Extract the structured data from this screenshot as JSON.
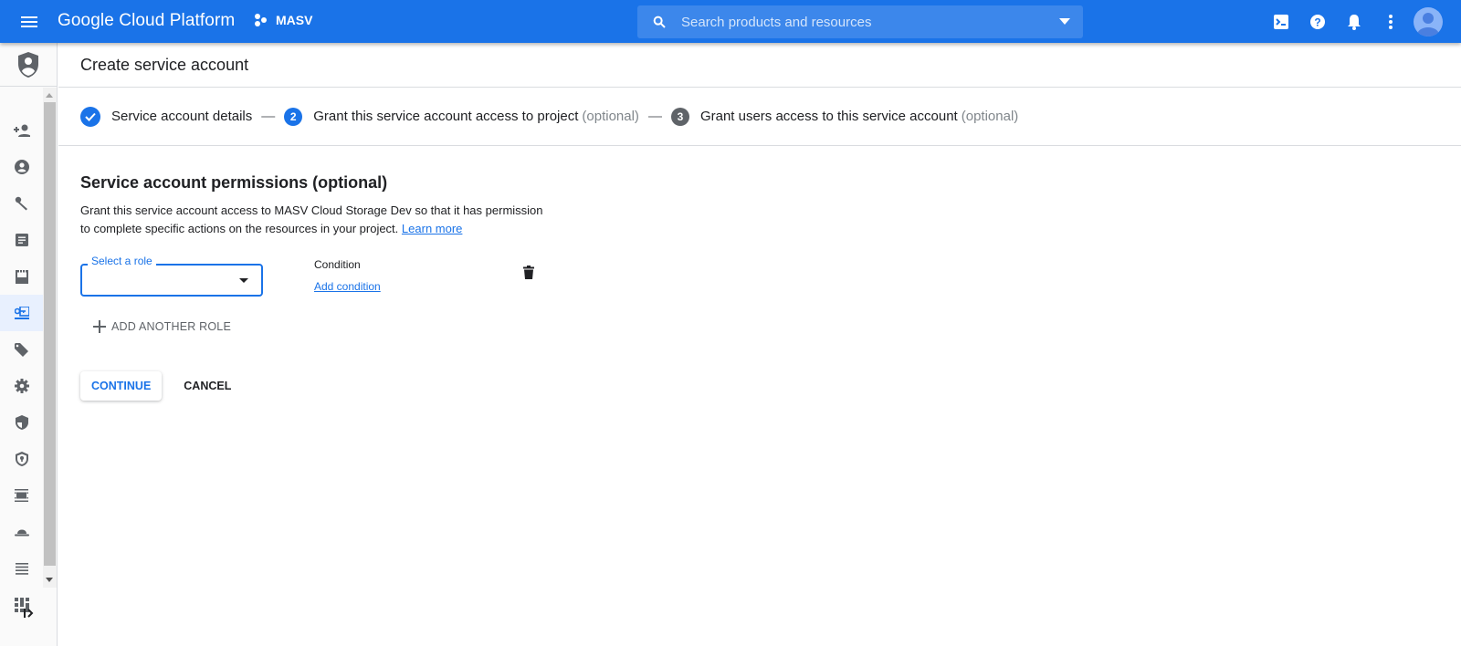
{
  "topbar": {
    "brand": "Google Cloud Platform",
    "project": "MASV",
    "search_placeholder": "Search products and resources",
    "icons": [
      "cloud-shell-icon",
      "help-icon",
      "notifications-icon",
      "more-vert-icon",
      "account-avatar"
    ]
  },
  "colors": {
    "topbar": "#1a73e8",
    "accent": "#1a73e8",
    "step_done": "#1a73e8",
    "step_active": "#1a73e8",
    "step_pending": "#5f6368",
    "nav_active_bg": "#e8f0fe"
  },
  "sidebar": {
    "header_icon": "iam-shield-icon",
    "items": [
      {
        "icon": "person-add-icon",
        "label": "IAM"
      },
      {
        "icon": "account-circle-icon",
        "label": "Identity & Organization"
      },
      {
        "icon": "wrench-icon",
        "label": "Policy Troubleshooter"
      },
      {
        "icon": "document-icon",
        "label": "Policy Analyzer"
      },
      {
        "icon": "organization-policies-icon",
        "label": "Organization Policies"
      },
      {
        "icon": "service-accounts-icon",
        "label": "Service Accounts",
        "active": true
      },
      {
        "icon": "tag-icon",
        "label": "Labels"
      },
      {
        "icon": "gear-icon",
        "label": "Settings"
      },
      {
        "icon": "privacy-shield-icon",
        "label": "Privacy & Security"
      },
      {
        "icon": "identity-aware-proxy-icon",
        "label": "Identity-Aware Proxy"
      },
      {
        "icon": "roles-icon",
        "label": "Roles"
      },
      {
        "icon": "audit-logs-icon",
        "label": "Audit Logs"
      },
      {
        "icon": "list-icon",
        "label": "Asset Inventory"
      },
      {
        "icon": "dashboard-icon",
        "label": "Essential Contacts"
      }
    ],
    "collapse_icon": "collapse-nav-icon"
  },
  "page": {
    "title": "Create service account",
    "steps": [
      {
        "number": "✓",
        "label": "Service account details",
        "optional": "",
        "state": "done"
      },
      {
        "number": "2",
        "label": "Grant this service account access to project",
        "optional": "(optional)",
        "state": "active"
      },
      {
        "number": "3",
        "label": "Grant users access to this service account",
        "optional": "(optional)",
        "state": "pending"
      }
    ],
    "step_separator": "—",
    "section_title": "Service account permissions (optional)",
    "description": "Grant this service account access to MASV Cloud Storage Dev so that it has permission to complete specific actions on the resources in your project.",
    "learn_more": "Learn more",
    "role_select_label": "Select a role",
    "role_select_value": "",
    "condition_label": "Condition",
    "add_condition": "Add condition",
    "add_another_role": "ADD ANOTHER ROLE",
    "continue": "CONTINUE",
    "cancel": "CANCEL"
  }
}
